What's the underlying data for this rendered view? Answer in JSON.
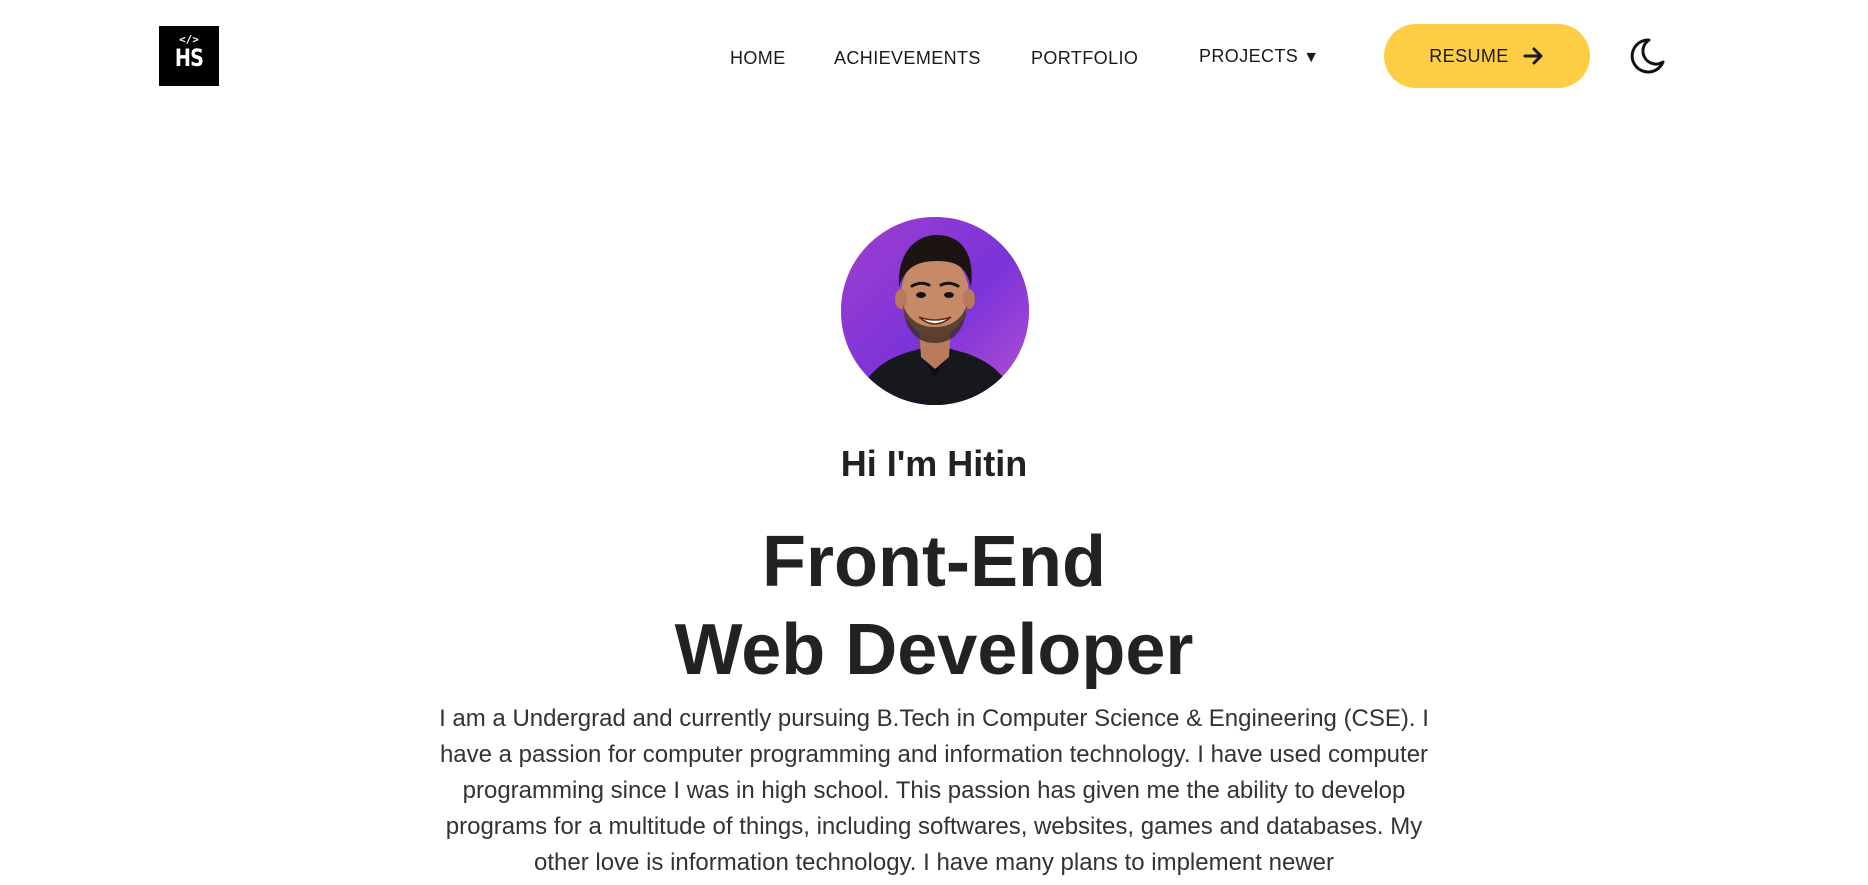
{
  "logo": {
    "code_glyph": "</>",
    "initials": "HS"
  },
  "nav": {
    "home": "HOME",
    "achievements": "ACHIEVEMENTS",
    "portfolio": "PORTFOLIO",
    "projects": "PROJECTS",
    "projects_caret": "▼",
    "resume": "RESUME"
  },
  "icons": {
    "resume_arrow": "arrow-right-icon",
    "theme_toggle": "moon-icon"
  },
  "colors": {
    "accent": "#fdcd44",
    "text": "#222222",
    "avatar_bg_start": "#9b3fc8",
    "avatar_bg_end": "#7c35d6"
  },
  "hero": {
    "greeting": "Hi I'm Hitin",
    "title_line1": "Front-End",
    "title_line2": "Web Developer",
    "bio": "I am a Undergrad and currently pursuing B.Tech in Computer Science & Engineering (CSE). I have a passion for computer programming and information technology. I have used computer programming since I was in high school. This passion has given me the ability to develop programs for a multitude of things, including softwares, websites, games and databases. My other love is information technology. I have many plans to implement newer"
  }
}
